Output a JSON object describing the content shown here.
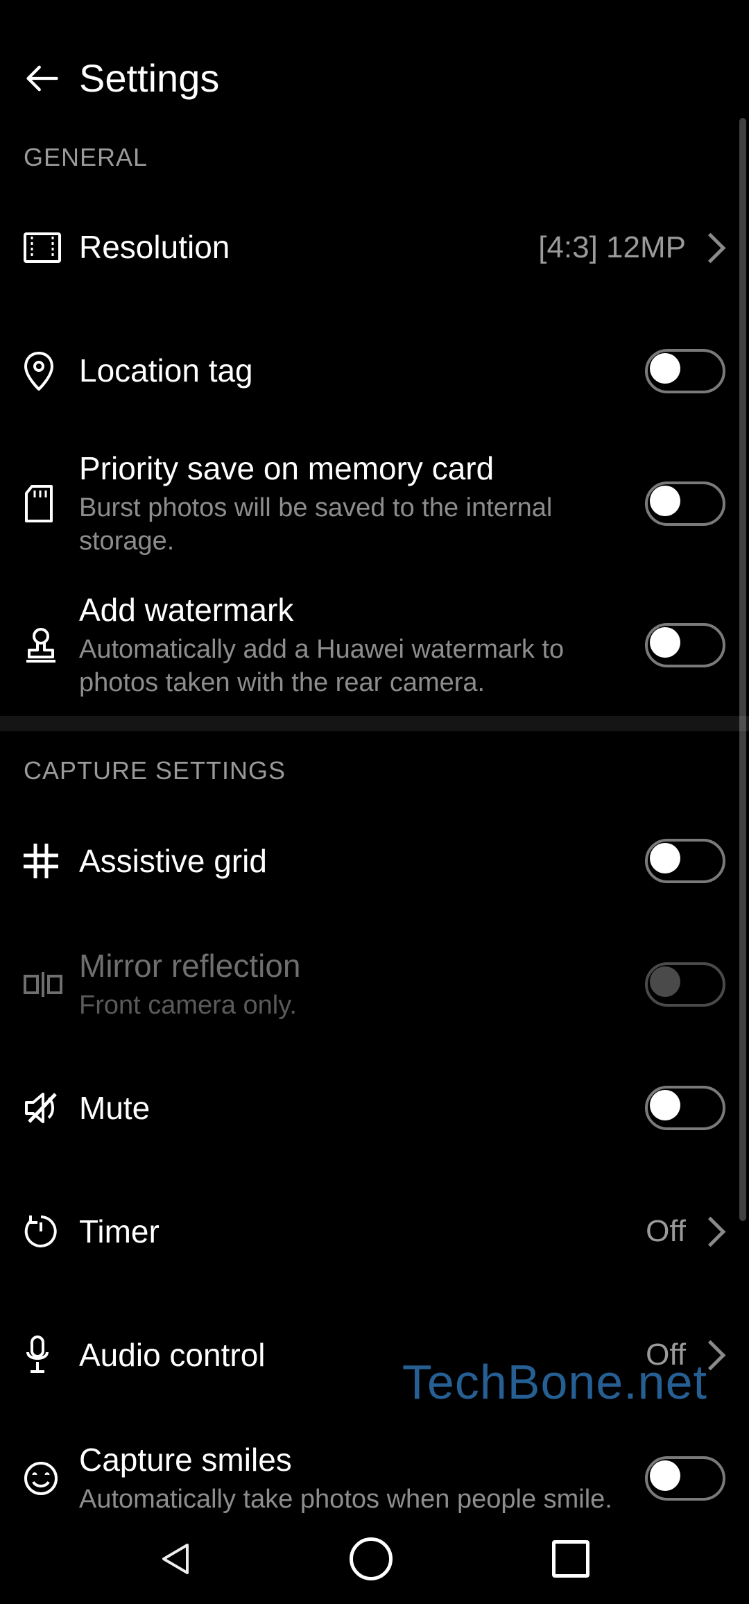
{
  "header": {
    "title": "Settings"
  },
  "sections": {
    "general": {
      "header": "GENERAL",
      "resolution": {
        "label": "Resolution",
        "value": "[4:3] 12MP"
      },
      "location_tag": {
        "label": "Location tag"
      },
      "priority_save": {
        "label": "Priority save on memory card",
        "sub": "Burst photos will be saved to the internal storage."
      },
      "watermark": {
        "label": "Add watermark",
        "sub": "Automatically add a Huawei watermark to photos taken with the rear camera."
      }
    },
    "capture": {
      "header": "CAPTURE SETTINGS",
      "assistive_grid": {
        "label": "Assistive grid"
      },
      "mirror": {
        "label": "Mirror reflection",
        "sub": "Front camera only."
      },
      "mute": {
        "label": "Mute"
      },
      "timer": {
        "label": "Timer",
        "value": "Off"
      },
      "audio_control": {
        "label": "Audio control",
        "value": "Off"
      },
      "capture_smiles": {
        "label": "Capture smiles",
        "sub": "Automatically take photos when people smile."
      }
    }
  },
  "image_watermark": "TechBone.net"
}
